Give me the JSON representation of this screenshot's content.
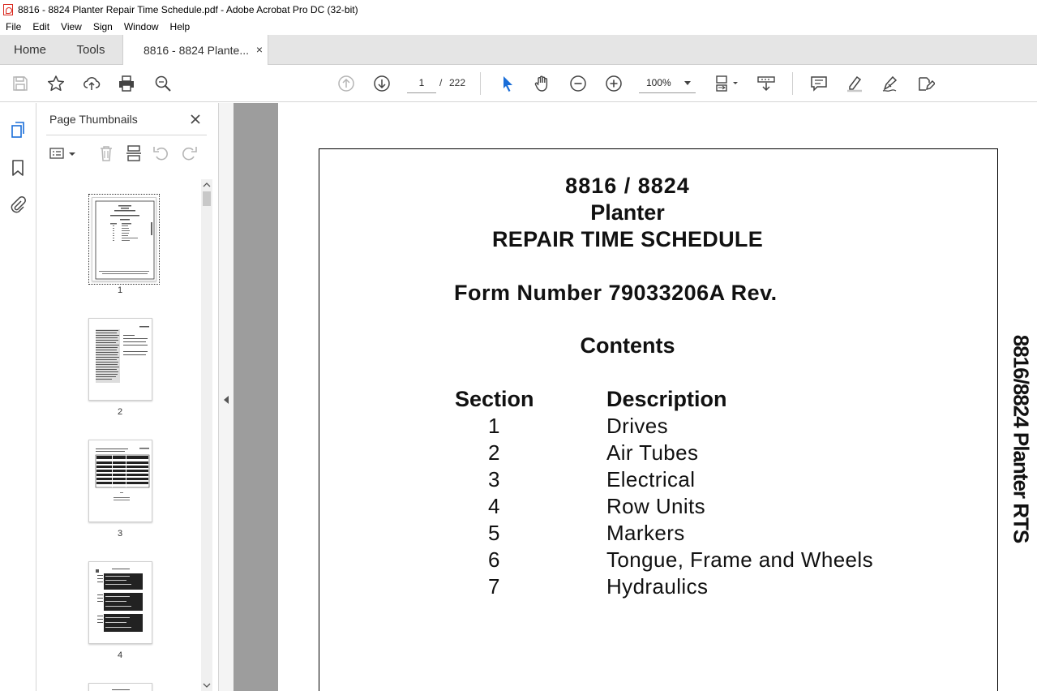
{
  "window": {
    "title": "8816 - 8824 Planter Repair Time Schedule.pdf - Adobe Acrobat Pro DC (32-bit)"
  },
  "menu": [
    "File",
    "Edit",
    "View",
    "Sign",
    "Window",
    "Help"
  ],
  "tabs": {
    "home": "Home",
    "tools": "Tools",
    "document": "8816 - 8824 Plante...",
    "close_glyph": "×"
  },
  "toolbar": {
    "current_page": "1",
    "page_separator": "/",
    "total_pages": "222",
    "zoom": "100%",
    "icons": [
      "save-icon",
      "bookmark-star-icon",
      "upload-icon",
      "print-icon",
      "find-icon",
      "previous-page-icon",
      "next-page-icon",
      "select-cursor-icon",
      "hand-icon",
      "zoom-out-icon",
      "zoom-in-icon",
      "page-fit-icon",
      "scroll-mode-icon",
      "comment-icon",
      "highlight-icon",
      "sign-icon",
      "edit-export-icon"
    ]
  },
  "thumbnails_panel": {
    "title": "Page Thumbnails",
    "pages": [
      {
        "label": "1",
        "selected": true
      },
      {
        "label": "2",
        "selected": false
      },
      {
        "label": "3",
        "selected": false
      },
      {
        "label": "4",
        "selected": false
      }
    ]
  },
  "document": {
    "heading_model": "8816 / 8824",
    "heading_machine": "Planter",
    "heading_title": "REPAIR TIME SCHEDULE",
    "form_number": "Form Number 79033206A Rev.",
    "contents_title": "Contents",
    "col_section": "Section",
    "col_description": "Description",
    "sections": [
      {
        "number": "1",
        "description": "Drives"
      },
      {
        "number": "2",
        "description": "Air Tubes"
      },
      {
        "number": "3",
        "description": "Electrical"
      },
      {
        "number": "4",
        "description": "Row Units"
      },
      {
        "number": "5",
        "description": "Markers"
      },
      {
        "number": "6",
        "description": "Tongue, Frame and Wheels"
      },
      {
        "number": "7",
        "description": "Hydraulics"
      }
    ],
    "side_label": "8816/8824 Planter RTS"
  },
  "colors": {
    "accent_blue": "#1a6ed8",
    "pdf_red": "#d9261c",
    "doc_gray": "#9d9d9d"
  }
}
